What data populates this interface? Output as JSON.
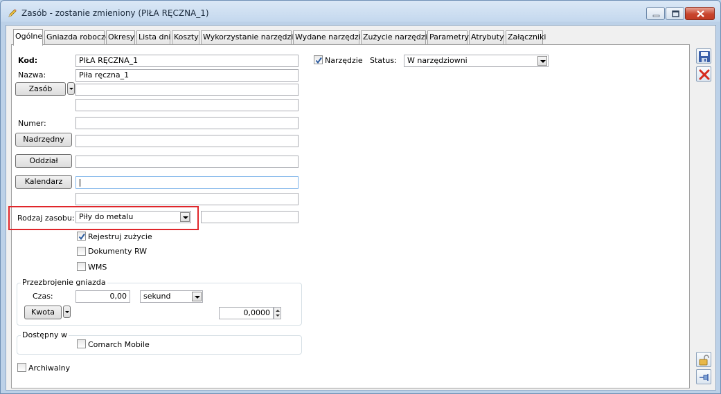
{
  "window": {
    "title": "Zasób - zostanie zmieniony  (PIŁA RĘCZNA_1)"
  },
  "tabs": [
    {
      "label": "Ogólne"
    },
    {
      "label": "Gniazda robocze"
    },
    {
      "label": "Okresy"
    },
    {
      "label": "Lista dni"
    },
    {
      "label": "Koszty"
    },
    {
      "label": "Wykorzystanie narzędzia"
    },
    {
      "label": "Wydane narzędzia"
    },
    {
      "label": "Zużycie narzędzia"
    },
    {
      "label": "Parametry"
    },
    {
      "label": "Atrybuty"
    },
    {
      "label": "Załączniki"
    }
  ],
  "form": {
    "kod_label": "Kod:",
    "kod_value": "PIŁA RĘCZNA_1",
    "nazwa_label": "Nazwa:",
    "nazwa_value": "Piła ręczna_1",
    "zasob_button": "Zasób",
    "zasob_value": "",
    "zasob_value2": "",
    "numer_label": "Numer:",
    "numer_value": "",
    "nadrzedny_button": "Nadrzędny",
    "nadrzedny_value": "",
    "oddzial_button": "Oddział",
    "oddzial_value": "",
    "kalendarz_button": "Kalendarz",
    "kalendarz_value": "",
    "kalendarz_value2": "",
    "rodzaj_label": "Rodzaj zasobu:",
    "rodzaj_value": "Piły do metalu",
    "rodzaj_extra": "",
    "rejestruj_label": "Rejestruj zużycie",
    "rejestruj_checked": true,
    "dokumenty_label": "Dokumenty RW",
    "dokumenty_checked": false,
    "wms_label": "WMS",
    "wms_checked": false,
    "przezbrojenie_title": "Przezbrojenie gniazda",
    "czas_label": "Czas:",
    "czas_value": "0,00",
    "czas_unit": "sekund",
    "kwota_button": "Kwota",
    "kwota_value": "0,0000",
    "dostepny_title": "Dostępny w",
    "comarch_label": "Comarch Mobile",
    "comarch_checked": false,
    "archiwalny_label": "Archiwalny",
    "archiwalny_checked": false,
    "narzedzie_label": "Narzędzie",
    "narzedzie_checked": true,
    "status_label": "Status:",
    "status_value": "W narzędziowni"
  },
  "colors": {
    "highlight": "#e0262b",
    "save_icon": "#3a5fa8",
    "cancel_icon": "#d62a1e"
  }
}
